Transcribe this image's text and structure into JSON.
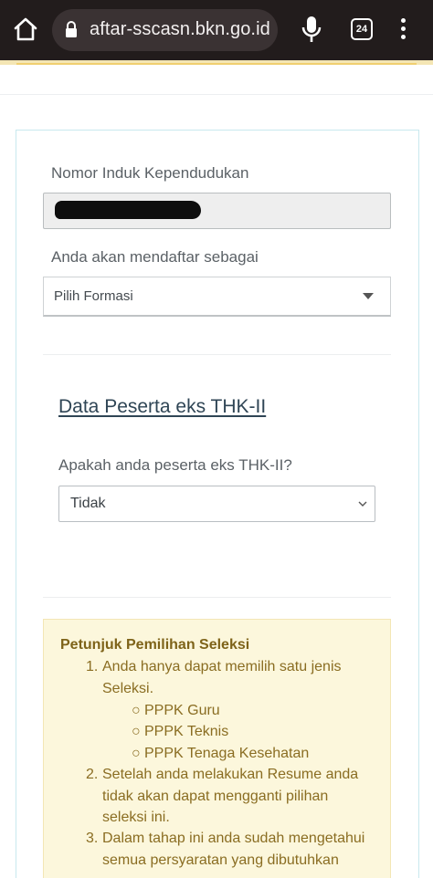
{
  "browser": {
    "url": "aftar-sscasn.bkn.go.id",
    "tab_count": "24"
  },
  "form": {
    "nik_label": "Nomor Induk Kependudukan",
    "daftar_label": "Anda akan mendaftar sebagai",
    "daftar_value": "Pilih Formasi",
    "thk_section_title": "Data Peserta eks THK-II",
    "thk_question": "Apakah anda peserta eks THK-II?",
    "thk_value": "Tidak"
  },
  "info": {
    "title": "Petunjuk Pemilihan Seleksi",
    "item1_line1": "Anda hanya dapat memilih satu jenis",
    "item1_line2": "Seleksi.",
    "sub_items": [
      "PPPK Guru",
      "PPPK Teknis",
      "PPPK Tenaga Kesehatan"
    ],
    "item2_line1": "Setelah anda melakukan Resume anda",
    "item2_line2": "tidak akan dapat mengganti pilihan",
    "item2_line3": "seleksi ini.",
    "item3_line1": "Dalam tahap ini anda sudah mengetahui",
    "item3_line2": "semua persyaratan yang dibutuhkan"
  }
}
